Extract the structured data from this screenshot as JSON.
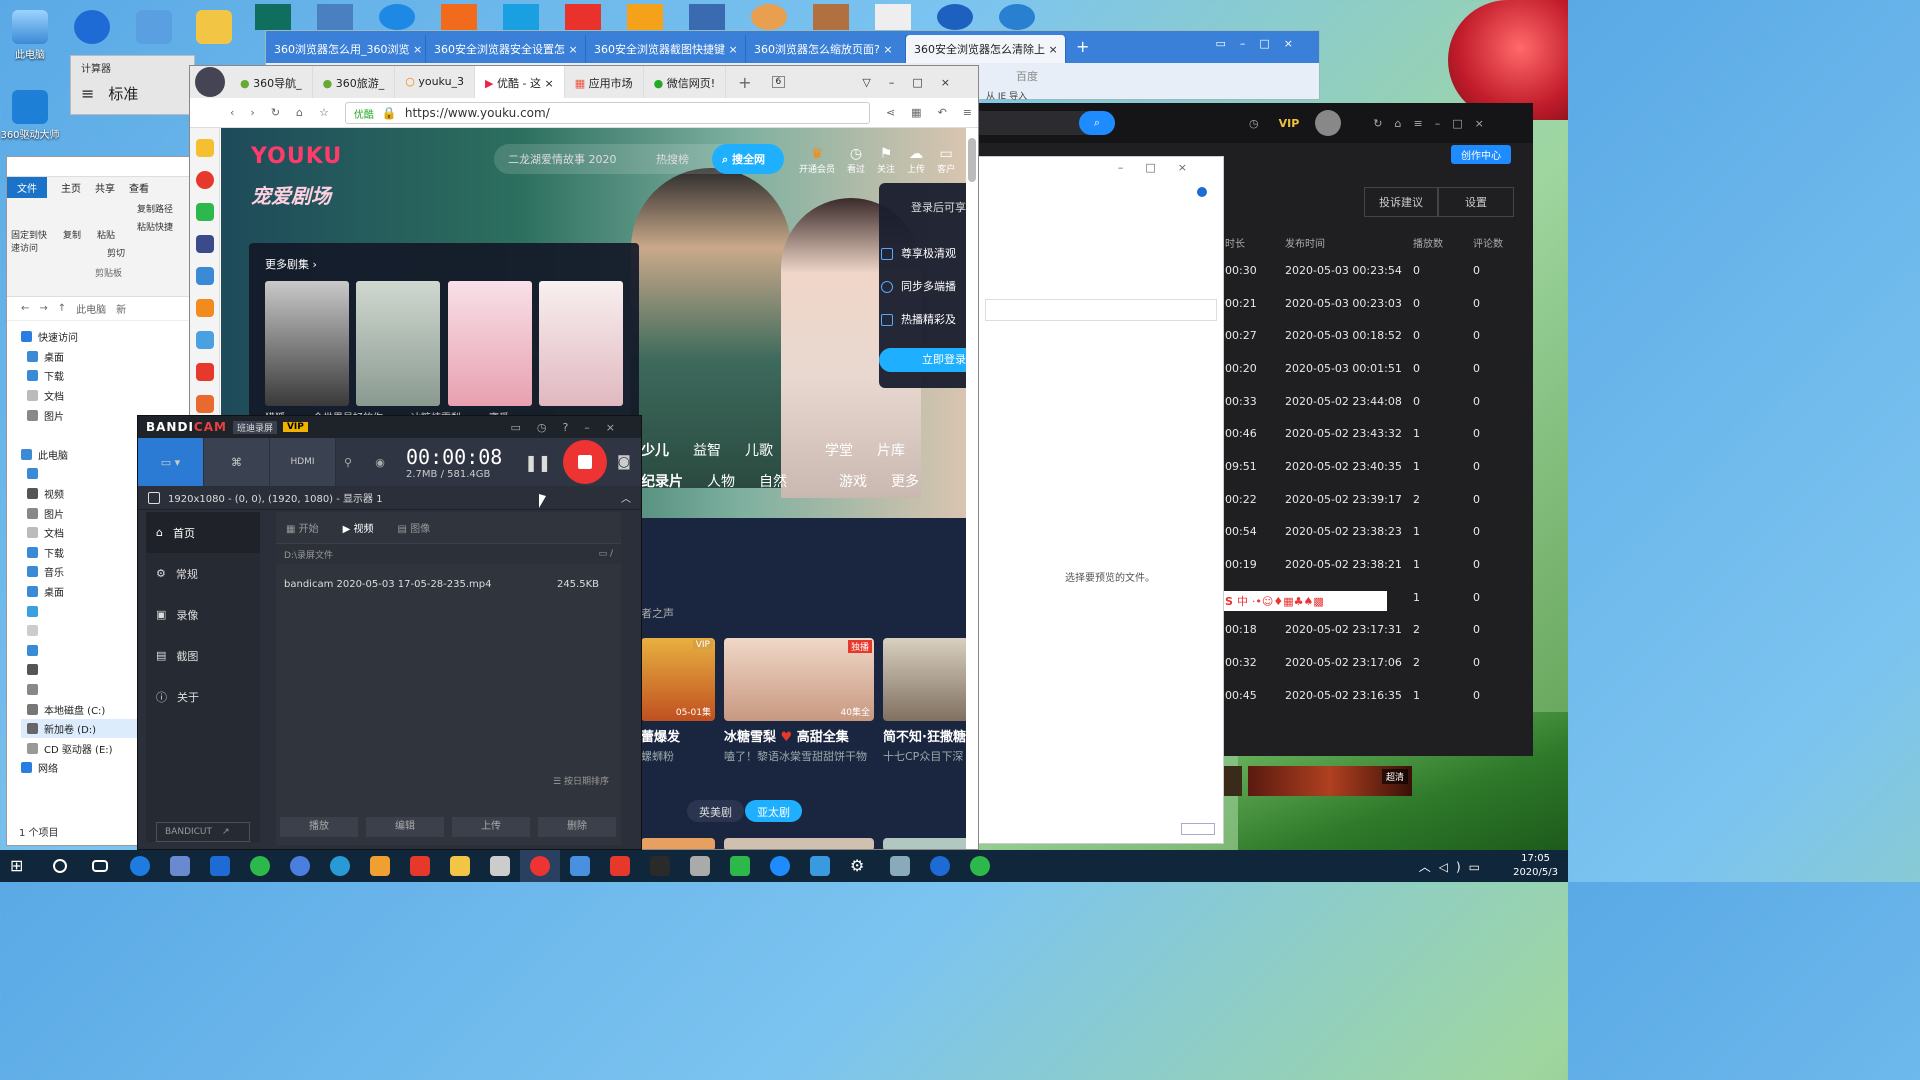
{
  "desktop": {
    "icons": [
      {
        "label": "此电脑"
      },
      {
        "label": ""
      },
      {
        "label": ""
      },
      {
        "label": ""
      },
      {
        "label": ""
      }
    ],
    "side_icon": "360驱动大师"
  },
  "calculator": {
    "title": "计算器",
    "mode": "标准"
  },
  "back_browser": {
    "tabs": [
      "360浏览器怎么用_360浏览",
      "360安全浏览器安全设置怎",
      "360安全浏览器截图快捷键",
      "360浏览器怎么缩放页面?",
      "360安全浏览器怎么清除上"
    ],
    "search_placeholder": "百度",
    "bookmark": "从 IE 导入"
  },
  "explorer": {
    "ribbon_tabs": [
      "文件",
      "主页",
      "共享",
      "查看"
    ],
    "ribbon_items": [
      "固定到快速访问",
      "复制",
      "粘贴",
      "复制路径",
      "粘贴快捷",
      "剪切",
      "剪贴板"
    ],
    "breadcrumb": [
      "此电脑",
      "新"
    ],
    "tree": [
      "快速访问",
      "桌面",
      "下载",
      "文档",
      "图片",
      "",
      "此电脑",
      "",
      "视频",
      "图片",
      "文档",
      "下载",
      "音乐",
      "桌面",
      "",
      "",
      "",
      "",
      "",
      "本地磁盘 (C:)",
      "新加卷 (D:)",
      "CD 驱动器 (E:)",
      "网络"
    ],
    "status": "1 个项目"
  },
  "creator": {
    "vip": "VIP",
    "badge": "创作中心",
    "buttons": [
      "投诉建议",
      "设置"
    ],
    "headers": [
      "时长",
      "发布时间",
      "播放数",
      "评论数"
    ],
    "rows": [
      [
        "00:30",
        "2020-05-03 00:23:54",
        "0",
        "0"
      ],
      [
        "00:21",
        "2020-05-03 00:23:03",
        "0",
        "0"
      ],
      [
        "00:27",
        "2020-05-03 00:18:52",
        "0",
        "0"
      ],
      [
        "00:20",
        "2020-05-03 00:01:51",
        "0",
        "0"
      ],
      [
        "00:33",
        "2020-05-02 23:44:08",
        "0",
        "0"
      ],
      [
        "00:46",
        "2020-05-02 23:43:32",
        "1",
        "0"
      ],
      [
        "09:51",
        "2020-05-02 23:40:35",
        "1",
        "0"
      ],
      [
        "00:22",
        "2020-05-02 23:39:17",
        "2",
        "0"
      ],
      [
        "00:54",
        "2020-05-02 23:38:23",
        "1",
        "0"
      ],
      [
        "00:19",
        "2020-05-02 23:38:21",
        "1",
        "0"
      ],
      [
        "",
        "",
        "1",
        "0"
      ],
      [
        "00:18",
        "2020-05-02 23:17:31",
        "2",
        "0"
      ],
      [
        "00:32",
        "2020-05-02 23:17:06",
        "2",
        "0"
      ],
      [
        "00:45",
        "2020-05-02 23:16:35",
        "1",
        "0"
      ]
    ],
    "thumb_badge": "超清"
  },
  "preview": {
    "message": "选择要预览的文件。"
  },
  "browser": {
    "tabs": [
      "360导航_",
      "360旅游_",
      "youku_3",
      "优酷 - 这",
      "应用市场",
      "微信网页!"
    ],
    "tab_count": "6",
    "url_label": "优酷",
    "url": "https://www.youku.com/"
  },
  "youku": {
    "logo": "YOUKU",
    "slogan": "宠爱剧场",
    "search_placeholder": "二龙湖爱情故事 2020",
    "hot": "热搜榜",
    "search_btn": "搜全网",
    "top_icons": [
      "开通会员",
      "看过",
      "关注",
      "上传",
      "客户"
    ],
    "more_eps": "更多剧集",
    "poster_titles": [
      "猎狐",
      "今世界最好的你",
      "冰糖炖雪梨",
      "蜜爱"
    ],
    "login_title": "登录后可享",
    "login_items": [
      "尊享极清观",
      "同步多端播",
      "热播精彩及"
    ],
    "login_btn": "立即登录",
    "cat_row1": [
      "少儿",
      "益智",
      "儿歌",
      "学堂",
      "片库"
    ],
    "cat_row2": [
      "纪录片",
      "人物",
      "自然",
      "游戏",
      "更多"
    ],
    "section": "者之声",
    "cards": [
      {
        "title": "蕾爆发",
        "sub": "螺蛳粉",
        "badge": "VIP",
        "eps": "05-01集"
      },
      {
        "title": "冰糖雪梨",
        "title_tail": "高甜全集",
        "sub": "嗑了！黎语冰棠雪甜甜饼干物",
        "badge": "独播",
        "eps": "40集全"
      },
      {
        "title": "简不知·狂撒糖",
        "sub": "十七CP众目下深"
      }
    ],
    "pills": [
      "英美剧",
      "亚太剧"
    ]
  },
  "bandicam": {
    "logo_a": "BANDI",
    "logo_b": "CAM",
    "edition": "班迪录屏",
    "vip": "VIP",
    "timer": "00:00:08",
    "size": "2.7MB / 581.4GB",
    "region": "1920x1080 - (0, 0), (1920, 1080) - 显示器 1",
    "sidebar": [
      "首页",
      "常规",
      "录像",
      "截图",
      "关于"
    ],
    "tabs": [
      "开始",
      "视频",
      "图像"
    ],
    "folder": "D:\\录屏文件",
    "file_name": "bandicam 2020-05-03 17-05-28-235.mp4",
    "file_size": "245.5KB",
    "sort": "按日期排序",
    "footer_btns": [
      "播放",
      "编辑",
      "上传",
      "删除"
    ],
    "bandicut": "BANDICUT"
  },
  "taskbar": {
    "time": "17:05",
    "date": "2020/5/3"
  }
}
